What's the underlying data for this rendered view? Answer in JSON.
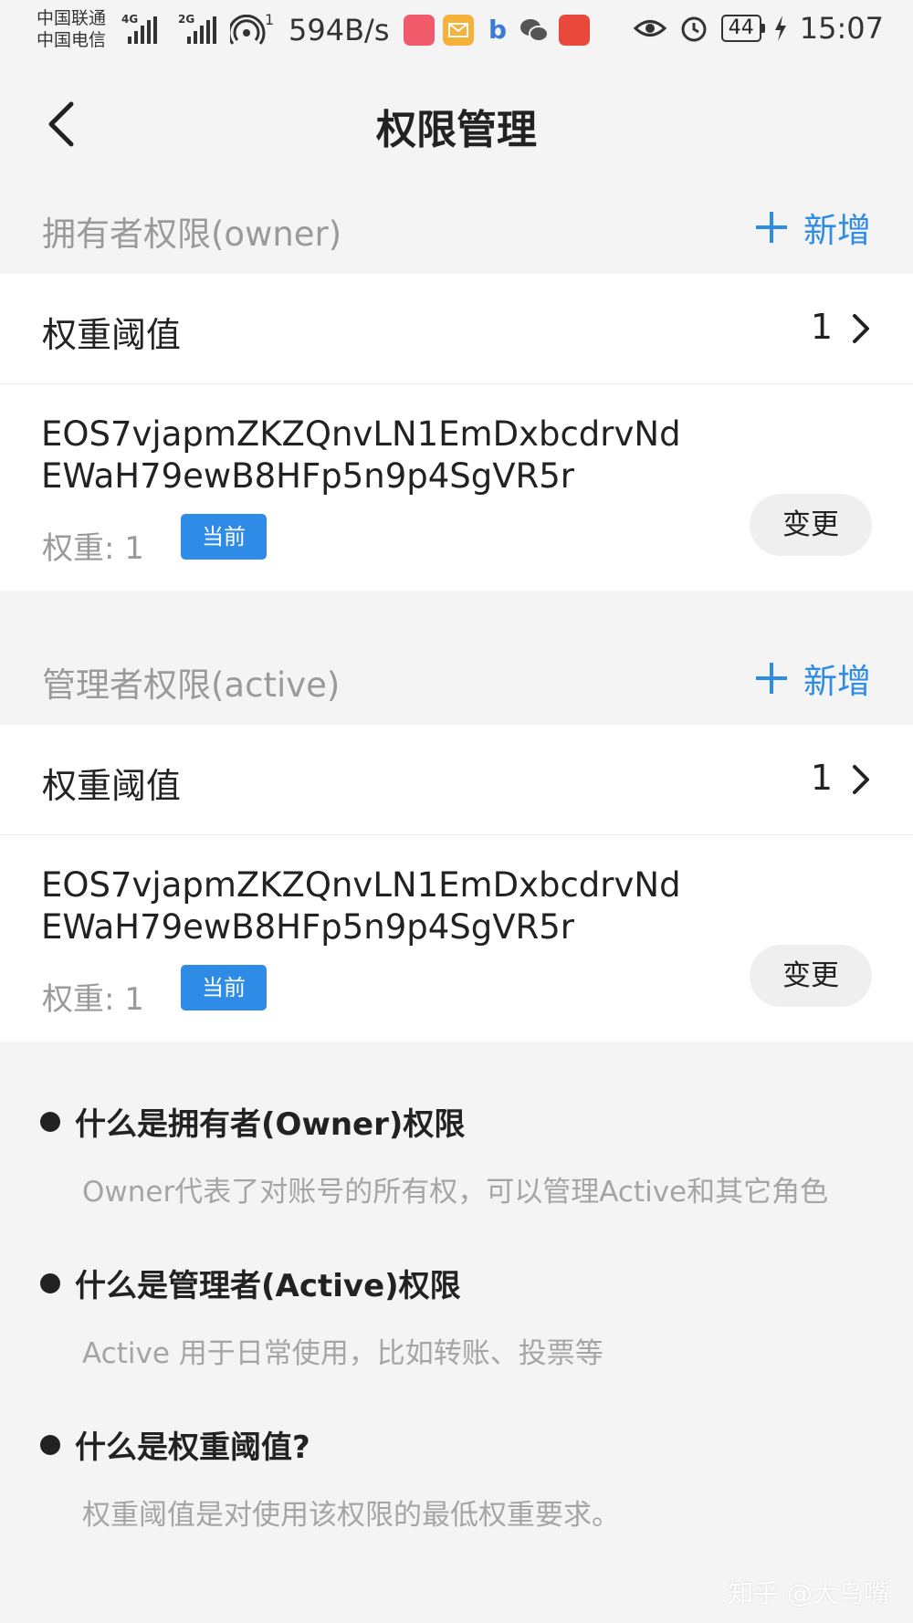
{
  "status_bar": {
    "carrier_1": "中国联通",
    "carrier_2": "中国电信",
    "net_1": "4G",
    "net_2": "2G",
    "wifi_level": "1",
    "speed": "594B/s",
    "battery": "44",
    "time": "15:07",
    "app_icons": [
      "shopping-app-icon",
      "mail-icon",
      "browser-icon",
      "wechat-icon",
      "game-app-icon"
    ]
  },
  "nav": {
    "title": "权限管理",
    "back_icon": "back-arrow-icon"
  },
  "owner": {
    "section_title": "拥有者权限(owner)",
    "add_label": "新增",
    "threshold_label": "权重阈值",
    "threshold_value": "1",
    "key": "EOS7vjapmZKZQnvLN1EmDxbcdrvNdEWaH79ewB8HFp5n9p4SgVR5r",
    "weight": "权重: 1",
    "badge": "当前",
    "change_label": "变更"
  },
  "active": {
    "section_title": "管理者权限(active)",
    "add_label": "新增",
    "threshold_label": "权重阈值",
    "threshold_value": "1",
    "key": "EOS7vjapmZKZQnvLN1EmDxbcdrvNdEWaH79ewB8HFp5n9p4SgVR5r",
    "weight": "权重: 1",
    "badge": "当前",
    "change_label": "变更"
  },
  "faq": [
    {
      "q": "什么是拥有者(Owner)权限",
      "a": "Owner代表了对账号的所有权，可以管理Active和其它角色"
    },
    {
      "q": "什么是管理者(Active)权限",
      "a": "Active 用于日常使用，比如转账、投票等"
    },
    {
      "q": "什么是权重阈值?",
      "a": "权重阈值是对使用该权限的最低权重要求。"
    }
  ],
  "watermark": "知乎 @大乌嘴",
  "colors": {
    "accent": "#2f8ce6",
    "background": "#f4f4f4",
    "muted_text": "#9a9a9a"
  }
}
